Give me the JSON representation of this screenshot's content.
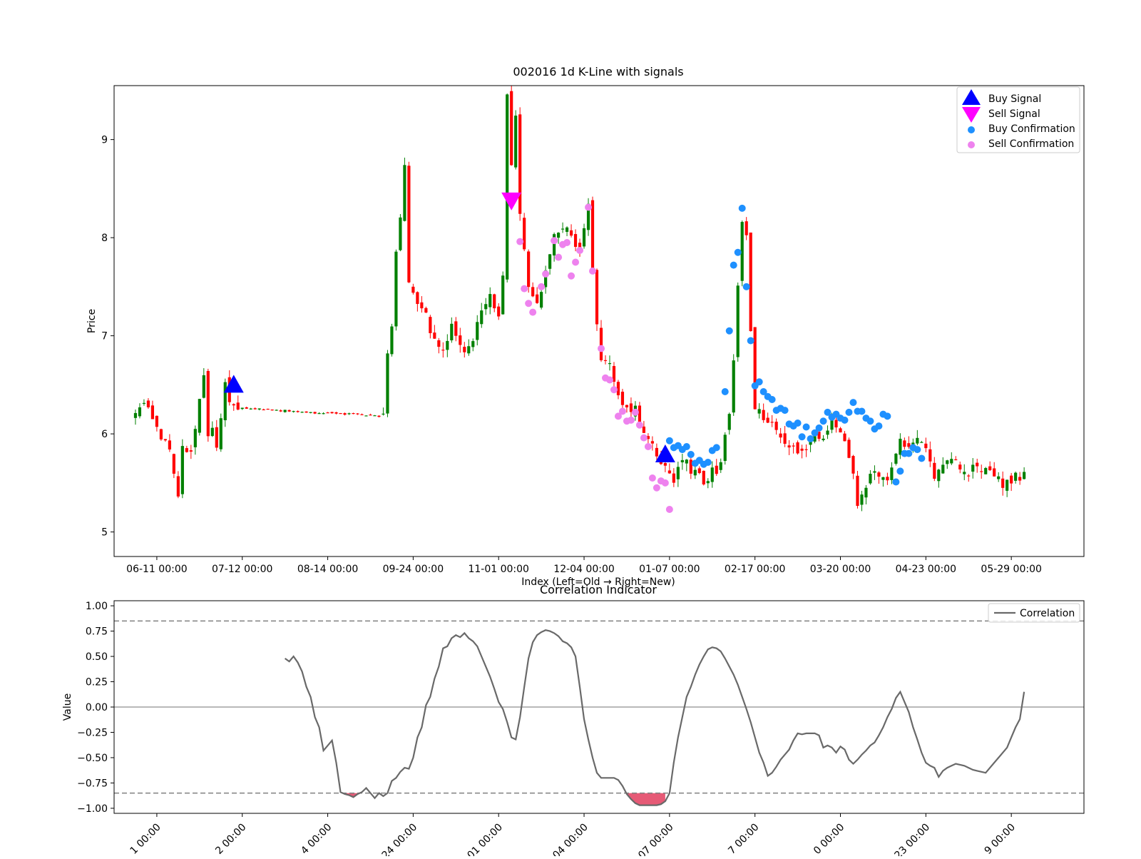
{
  "chart_data": [
    {
      "type": "candlestick",
      "title": "002016 1d K-Line with signals",
      "xlabel": "Index (Left=Old → Right=New)",
      "ylabel": "Price",
      "ylim": [
        4.75,
        9.55
      ],
      "yticks": [
        5,
        6,
        7,
        8,
        9
      ],
      "x_range": [
        -5,
        222
      ],
      "xtick_index": [
        5,
        25,
        45,
        65,
        85,
        105,
        125,
        145,
        165,
        185,
        205
      ],
      "xtick_labels": [
        "06-11 00:00",
        "07-12 00:00",
        "08-14 00:00",
        "09-24 00:00",
        "11-01 00:00",
        "12-04 00:00",
        "01-07 00:00",
        "02-17 00:00",
        "03-20 00:00",
        "04-23 00:00",
        "05-29 00:00"
      ],
      "up_color": "#008000",
      "down_color": "#ff0000",
      "close_anchors": [
        [
          0,
          6.2
        ],
        [
          2,
          6.3
        ],
        [
          4,
          6.15
        ],
        [
          6,
          6.0
        ],
        [
          8,
          5.8
        ],
        [
          9,
          5.6
        ],
        [
          10,
          5.35
        ],
        [
          11,
          5.9
        ],
        [
          13,
          5.8
        ],
        [
          14,
          6.1
        ],
        [
          15,
          6.4
        ],
        [
          16,
          6.6
        ],
        [
          17,
          5.95
        ],
        [
          18,
          6.1
        ],
        [
          19,
          5.8
        ],
        [
          21,
          6.5
        ],
        [
          22,
          6.3
        ],
        [
          24,
          6.27
        ],
        [
          30,
          6.25
        ],
        [
          40,
          6.22
        ],
        [
          50,
          6.2
        ],
        [
          58,
          6.18
        ],
        [
          59,
          6.8
        ],
        [
          60,
          7.1
        ],
        [
          61,
          7.9
        ],
        [
          62,
          8.2
        ],
        [
          63,
          8.8
        ],
        [
          64,
          7.5
        ],
        [
          66,
          7.3
        ],
        [
          68,
          7.2
        ],
        [
          70,
          6.95
        ],
        [
          72,
          6.85
        ],
        [
          74,
          7.1
        ],
        [
          75,
          7.0
        ],
        [
          77,
          6.8
        ],
        [
          79,
          6.9
        ],
        [
          81,
          7.3
        ],
        [
          83,
          7.4
        ],
        [
          85,
          7.15
        ],
        [
          86,
          7.6
        ],
        [
          87,
          9.5
        ],
        [
          88,
          8.7
        ],
        [
          89,
          9.3
        ],
        [
          90,
          8.2
        ],
        [
          91,
          7.9
        ],
        [
          92,
          7.5
        ],
        [
          94,
          7.3
        ],
        [
          96,
          7.7
        ],
        [
          98,
          8.0
        ],
        [
          100,
          8.1
        ],
        [
          102,
          8.0
        ],
        [
          104,
          7.9
        ],
        [
          106,
          8.4
        ],
        [
          107,
          7.7
        ],
        [
          108,
          7.1
        ],
        [
          109,
          6.8
        ],
        [
          111,
          6.7
        ],
        [
          113,
          6.4
        ],
        [
          115,
          6.3
        ],
        [
          117,
          6.25
        ],
        [
          119,
          6.0
        ],
        [
          121,
          5.85
        ],
        [
          123,
          5.7
        ],
        [
          125,
          5.6
        ],
        [
          126,
          5.5
        ],
        [
          127,
          5.65
        ],
        [
          129,
          5.7
        ],
        [
          131,
          5.6
        ],
        [
          133,
          5.5
        ],
        [
          135,
          5.6
        ],
        [
          137,
          5.7
        ],
        [
          139,
          6.2
        ],
        [
          140,
          6.8
        ],
        [
          141,
          7.5
        ],
        [
          142,
          8.2
        ],
        [
          143,
          8.0
        ],
        [
          144,
          7.0
        ],
        [
          145,
          6.3
        ],
        [
          147,
          6.2
        ],
        [
          149,
          6.1
        ],
        [
          151,
          6.0
        ],
        [
          153,
          5.85
        ],
        [
          155,
          5.8
        ],
        [
          157,
          5.9
        ],
        [
          159,
          6.0
        ],
        [
          161,
          5.95
        ],
        [
          163,
          6.1
        ],
        [
          165,
          6.0
        ],
        [
          167,
          5.8
        ],
        [
          168,
          5.6
        ],
        [
          169,
          5.3
        ],
        [
          171,
          5.5
        ],
        [
          173,
          5.6
        ],
        [
          175,
          5.55
        ],
        [
          177,
          5.6
        ],
        [
          179,
          5.9
        ],
        [
          181,
          5.85
        ],
        [
          183,
          5.95
        ],
        [
          185,
          5.9
        ],
        [
          187,
          5.55
        ],
        [
          189,
          5.7
        ],
        [
          191,
          5.7
        ],
        [
          193,
          5.65
        ],
        [
          195,
          5.6
        ],
        [
          197,
          5.7
        ],
        [
          199,
          5.6
        ],
        [
          201,
          5.55
        ],
        [
          203,
          5.5
        ],
        [
          205,
          5.55
        ],
        [
          207,
          5.55
        ],
        [
          208,
          5.6
        ]
      ],
      "buy_signal": [
        [
          23,
          6.5
        ],
        [
          124,
          5.79
        ]
      ],
      "sell_signal": [
        [
          88,
          8.38
        ]
      ],
      "buy_confirmation": [
        [
          125,
          5.93
        ],
        [
          126,
          5.86
        ],
        [
          127,
          5.88
        ],
        [
          128,
          5.84
        ],
        [
          129,
          5.87
        ],
        [
          130,
          5.79
        ],
        [
          131,
          5.7
        ],
        [
          132,
          5.73
        ],
        [
          133,
          5.69
        ],
        [
          134,
          5.71
        ],
        [
          135,
          5.83
        ],
        [
          136,
          5.86
        ],
        [
          138,
          6.43
        ],
        [
          139,
          7.05
        ],
        [
          140,
          7.72
        ],
        [
          141,
          7.85
        ],
        [
          142,
          8.3
        ],
        [
          143,
          7.5
        ],
        [
          144,
          6.95
        ],
        [
          145,
          6.49
        ],
        [
          146,
          6.53
        ],
        [
          147,
          6.43
        ],
        [
          148,
          6.38
        ],
        [
          149,
          6.35
        ],
        [
          150,
          6.24
        ],
        [
          151,
          6.26
        ],
        [
          152,
          6.24
        ],
        [
          153,
          6.1
        ],
        [
          154,
          6.08
        ],
        [
          155,
          6.11
        ],
        [
          156,
          5.97
        ],
        [
          157,
          6.07
        ],
        [
          158,
          5.95
        ],
        [
          159,
          6.01
        ],
        [
          160,
          6.06
        ],
        [
          161,
          6.13
        ],
        [
          162,
          6.22
        ],
        [
          163,
          6.17
        ],
        [
          164,
          6.2
        ],
        [
          165,
          6.16
        ],
        [
          166,
          6.14
        ],
        [
          167,
          6.22
        ],
        [
          168,
          6.32
        ],
        [
          169,
          6.23
        ],
        [
          170,
          6.23
        ],
        [
          171,
          6.16
        ],
        [
          172,
          6.13
        ],
        [
          173,
          6.05
        ],
        [
          174,
          6.08
        ],
        [
          175,
          6.2
        ],
        [
          176,
          6.18
        ],
        [
          178,
          5.51
        ],
        [
          179,
          5.62
        ],
        [
          180,
          5.8
        ],
        [
          181,
          5.8
        ],
        [
          182,
          5.86
        ],
        [
          183,
          5.84
        ],
        [
          184,
          5.75
        ]
      ],
      "sell_confirmation": [
        [
          90,
          7.96
        ],
        [
          91,
          7.48
        ],
        [
          92,
          7.33
        ],
        [
          93,
          7.24
        ],
        [
          95,
          7.5
        ],
        [
          96,
          7.63
        ],
        [
          98,
          7.97
        ],
        [
          99,
          7.8
        ],
        [
          100,
          7.93
        ],
        [
          101,
          7.95
        ],
        [
          102,
          7.61
        ],
        [
          103,
          7.75
        ],
        [
          104,
          7.87
        ],
        [
          106,
          8.31
        ],
        [
          107,
          7.66
        ],
        [
          109,
          6.87
        ],
        [
          110,
          6.57
        ],
        [
          111,
          6.55
        ],
        [
          112,
          6.45
        ],
        [
          113,
          6.18
        ],
        [
          114,
          6.23
        ],
        [
          115,
          6.13
        ],
        [
          116,
          6.14
        ],
        [
          117,
          6.22
        ],
        [
          118,
          6.09
        ],
        [
          119,
          5.96
        ],
        [
          120,
          5.87
        ],
        [
          121,
          5.55
        ],
        [
          122,
          5.45
        ],
        [
          123,
          5.52
        ],
        [
          124,
          5.5
        ],
        [
          125,
          5.23
        ]
      ],
      "legend": {
        "position": "upper right",
        "entries": [
          "Buy Signal",
          "Sell Signal",
          "Buy Confirmation",
          "Sell Confirmation"
        ]
      },
      "colors": {
        "buy_signal": "#0000ff",
        "sell_signal": "#ff00ff",
        "buy_confirmation": "#1e90ff",
        "sell_confirmation": "#ee82ee"
      }
    },
    {
      "type": "line",
      "title": "Correlation Indicator",
      "ylabel": "Value",
      "ylim": [
        -1.05,
        1.05
      ],
      "yticks": [
        1.0,
        0.75,
        0.5,
        0.25,
        0.0,
        -0.25,
        -0.5,
        -0.75,
        -1.0
      ],
      "ytick_labels": [
        "1.00",
        "0.75",
        "0.50",
        "0.25",
        "0.00",
        "−0.25",
        "−0.50",
        "−0.75",
        "−1.00"
      ],
      "xtick_index": [
        5,
        25,
        45,
        65,
        85,
        105,
        125,
        145,
        165,
        185,
        205
      ],
      "xtick_labels": [
        "1 00:00",
        "2 00:00",
        "4 00:00",
        "24 00:00",
        "01 00:00",
        "04 00:00",
        "07 00:00",
        "7 00:00",
        "0 00:00",
        "23 00:00",
        "9 00:00"
      ],
      "reference_lines": {
        "upper": 0.85,
        "zero": 0.0,
        "lower": -0.85
      },
      "series": [
        {
          "name": "Correlation",
          "color": "#696969",
          "x": [
            35,
            36,
            37,
            38,
            39,
            40,
            41,
            42,
            43,
            44,
            45,
            46,
            47,
            48,
            49,
            50,
            51,
            52,
            53,
            54,
            55,
            56,
            57,
            58,
            59,
            60,
            61,
            62,
            63,
            64,
            65,
            66,
            67,
            68,
            69,
            70,
            71,
            72,
            73,
            74,
            75,
            76,
            77,
            78,
            79,
            80,
            81,
            82,
            83,
            84,
            85,
            86,
            87,
            88,
            89,
            90,
            91,
            92,
            93,
            94,
            95,
            96,
            97,
            98,
            99,
            100,
            101,
            102,
            103,
            104,
            105,
            106,
            107,
            108,
            109,
            110,
            111,
            112,
            113,
            114,
            115,
            116,
            117,
            118,
            119,
            120,
            121,
            122,
            123,
            124,
            125,
            126,
            127,
            128,
            129,
            130,
            131,
            132,
            133,
            134,
            135,
            136,
            137,
            138,
            139,
            140,
            141,
            142,
            143,
            144,
            145,
            146,
            147,
            148,
            149,
            150,
            151,
            152,
            153,
            154,
            155,
            156,
            157,
            158,
            159,
            160,
            161,
            162,
            163,
            164,
            165,
            166,
            167,
            168,
            169,
            170,
            171,
            172,
            173,
            174,
            175,
            176,
            177,
            178,
            179,
            180,
            181,
            182,
            183,
            184,
            185,
            186,
            187,
            188,
            189,
            190,
            191,
            192,
            193,
            194,
            195,
            196,
            197,
            198,
            199,
            200,
            201,
            202,
            203,
            204,
            205,
            206,
            207,
            208
          ],
          "values": [
            0.48,
            0.45,
            0.5,
            0.44,
            0.35,
            0.2,
            0.1,
            -0.1,
            -0.2,
            -0.43,
            -0.38,
            -0.33,
            -0.55,
            -0.84,
            -0.86,
            -0.87,
            -0.89,
            -0.86,
            -0.84,
            -0.8,
            -0.85,
            -0.9,
            -0.85,
            -0.88,
            -0.85,
            -0.73,
            -0.7,
            -0.64,
            -0.6,
            -0.61,
            -0.5,
            -0.3,
            -0.2,
            0.02,
            0.1,
            0.28,
            0.4,
            0.58,
            0.6,
            0.68,
            0.71,
            0.69,
            0.73,
            0.68,
            0.65,
            0.6,
            0.5,
            0.4,
            0.3,
            0.18,
            0.05,
            -0.02,
            -0.15,
            -0.3,
            -0.32,
            -0.1,
            0.2,
            0.48,
            0.64,
            0.71,
            0.74,
            0.76,
            0.75,
            0.73,
            0.7,
            0.65,
            0.63,
            0.59,
            0.5,
            0.2,
            -0.12,
            -0.32,
            -0.5,
            -0.65,
            -0.7,
            -0.7,
            -0.7,
            -0.7,
            -0.72,
            -0.78,
            -0.86,
            -0.91,
            -0.95,
            -0.97,
            -0.97,
            -0.97,
            -0.97,
            -0.97,
            -0.96,
            -0.93,
            -0.85,
            -0.55,
            -0.3,
            -0.1,
            0.1,
            0.2,
            0.32,
            0.42,
            0.5,
            0.57,
            0.59,
            0.58,
            0.55,
            0.48,
            0.4,
            0.32,
            0.22,
            0.1,
            -0.02,
            -0.15,
            -0.3,
            -0.45,
            -0.55,
            -0.68,
            -0.65,
            -0.59,
            -0.52,
            -0.47,
            -0.42,
            -0.33,
            -0.26,
            -0.27,
            -0.26,
            -0.26,
            -0.26,
            -0.28,
            -0.4,
            -0.38,
            -0.4,
            -0.45,
            -0.39,
            -0.42,
            -0.52,
            -0.56,
            -0.52,
            -0.47,
            -0.43,
            -0.38,
            -0.35,
            -0.28,
            -0.2,
            -0.1,
            -0.02,
            0.09,
            0.15,
            0.05,
            -0.05,
            -0.2,
            -0.32,
            -0.45,
            -0.55,
            -0.58,
            -0.6,
            -0.69,
            -0.63,
            -0.6,
            -0.58,
            -0.56,
            -0.57,
            -0.58,
            -0.6,
            -0.62,
            -0.63,
            -0.64,
            -0.65,
            -0.6,
            -0.55,
            -0.5,
            -0.45,
            -0.4,
            -0.3,
            -0.2,
            -0.12,
            0.15
          ]
        }
      ],
      "fill_below": {
        "threshold": -0.85,
        "color": "#dc143c"
      },
      "legend": {
        "position": "upper right",
        "entries": [
          "Correlation"
        ]
      }
    }
  ]
}
